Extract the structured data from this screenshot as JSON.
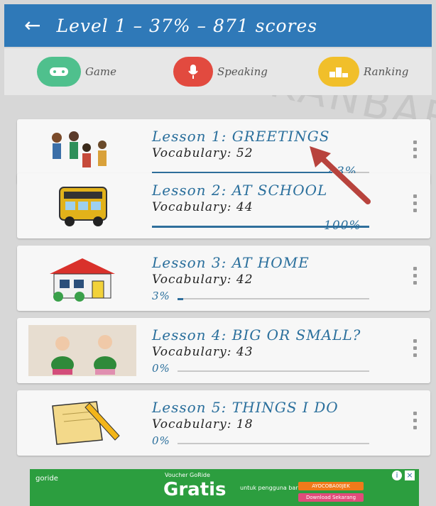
{
  "appbar": {
    "title": "Level 1 – 37% – 871 scores"
  },
  "tabs": [
    {
      "label": "Game",
      "icon": "gamepad-icon"
    },
    {
      "label": "Speaking",
      "icon": "microphone-icon"
    },
    {
      "label": "Ranking",
      "icon": "podium-icon"
    }
  ],
  "lessons": [
    {
      "title": "Lesson 1: GREETINGS",
      "vocab": "Vocabulary: 52",
      "percent_text": "83%",
      "progress": 0.83
    },
    {
      "title": "Lesson 2: AT SCHOOL",
      "vocab": "Vocabulary: 44",
      "percent_text": "100%",
      "progress": 1.0
    },
    {
      "title": "Lesson 3: AT HOME",
      "vocab": "Vocabulary: 42",
      "percent_text": "3%",
      "progress": 0.03
    },
    {
      "title": "Lesson 4: BIG OR SMALL?",
      "vocab": "Vocabulary: 43",
      "percent_text": "0%",
      "progress": 0
    },
    {
      "title": "Lesson 5: THINGS I DO",
      "vocab": "Vocabulary: 18",
      "percent_text": "0%",
      "progress": 0
    }
  ],
  "ad": {
    "brand": "goride",
    "headline": "Gratis",
    "line1": "Voucher GoRide",
    "line2": "untuk pengguna baru",
    "code": "AYOCOBA00JEK",
    "download": "Download Sekarang"
  },
  "watermark": "PEKANBAR",
  "colors": {
    "appbar": "#2f79b8",
    "accent": "#2a6f9c",
    "game": "#4fc08d",
    "speaking": "#e24a3f",
    "ranking": "#f1bf2a"
  }
}
